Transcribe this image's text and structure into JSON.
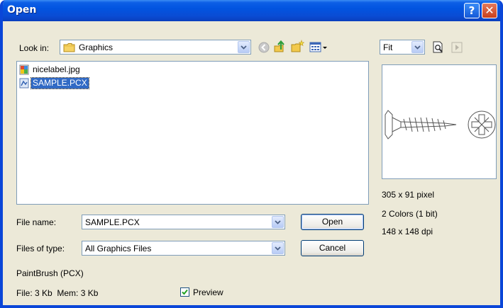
{
  "window": {
    "title": "Open",
    "help_glyph": "?",
    "close_glyph": "✕"
  },
  "look_in": {
    "label": "Look in:",
    "value": "Graphics"
  },
  "toolbar_icons": [
    "back-icon",
    "up-folder-icon",
    "new-folder-icon",
    "view-menu-icon"
  ],
  "zoom": {
    "value": "Fit"
  },
  "files": [
    {
      "name": "nicelabel.jpg",
      "icon": "jpg-file-icon",
      "selected": false
    },
    {
      "name": "SAMPLE.PCX",
      "icon": "pcx-file-icon",
      "selected": true
    }
  ],
  "file_name": {
    "label": "File name:",
    "value": "SAMPLE.PCX"
  },
  "files_of_type": {
    "label": "Files of type:",
    "value": "All Graphics Files"
  },
  "buttons": {
    "open": "Open",
    "cancel": "Cancel"
  },
  "image_info": {
    "size": "305 x 91 pixel",
    "colors": "2 Colors (1 bit)",
    "dpi": "148 x 148 dpi"
  },
  "format": "PaintBrush (PCX)",
  "file_stats": "File: 3 Kb  Mem: 3 Kb",
  "preview_checkbox": {
    "label": "Preview",
    "checked": true
  },
  "colors": {
    "title_bar": "#0a4cd4",
    "dialog_bg": "#ece9d8",
    "selection": "#316ac5",
    "field_border": "#7f9db9"
  }
}
